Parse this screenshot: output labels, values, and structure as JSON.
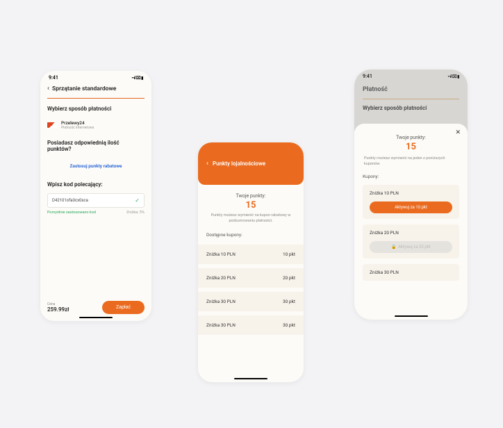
{
  "status": {
    "time": "9:41",
    "icons": "••ıl ⌧ ▮"
  },
  "phone1": {
    "title": "Sprzątanie standardowe",
    "pay_title": "Wybierz sposób płatności",
    "payment": {
      "name": "Przelewy24",
      "desc": "Płatność internetowa"
    },
    "points_question": "Posiadasz odpowiednią ilość punktów?",
    "apply_link": "Zastosuj punkty rabatowe",
    "code_title": "Wpisz kod polecający:",
    "code_value": "D42101ofa0cx0sca",
    "code_success": "Pomyślnie zastosowano kod",
    "code_discount": "Zniżka: 5%",
    "price_label": "Cena",
    "price_value": "259.99zł",
    "pay_btn": "Zapłać"
  },
  "phone2": {
    "title": "Punkty lojalnościowe",
    "points_label": "Twoje punkty:",
    "points_value": "15",
    "points_desc": "Punkty możesz wymienić na kupon rabatowy w podsumowaniu płatności.",
    "list_label": "Dostępne kupony:",
    "coupons": [
      {
        "name": "Zniżka 10 PLN",
        "pts": "10 pkt"
      },
      {
        "name": "Zniżka 20 PLN",
        "pts": "20 pkt"
      },
      {
        "name": "Zniżka 30 PLN",
        "pts": "30 pkt"
      },
      {
        "name": "Zniżka 30 PLN",
        "pts": "30 pkt"
      }
    ]
  },
  "phone3": {
    "header": "Płatność",
    "pay_title": "Wybierz sposób płatności",
    "sheet": {
      "points_label": "Twoje punkty:",
      "points_value": "15",
      "desc": "Punkty możesz wymienić na jeden z poniższych kuponów.",
      "list_label": "Kupony:",
      "c1": "Zniżka 10 PLN",
      "c1_btn": "Aktywuj za 10 pkt",
      "c2": "Zniżka 20 PLN",
      "c2_btn": "Aktywuj za 20 pkt",
      "c3": "Zniżka 30 PLN"
    }
  }
}
